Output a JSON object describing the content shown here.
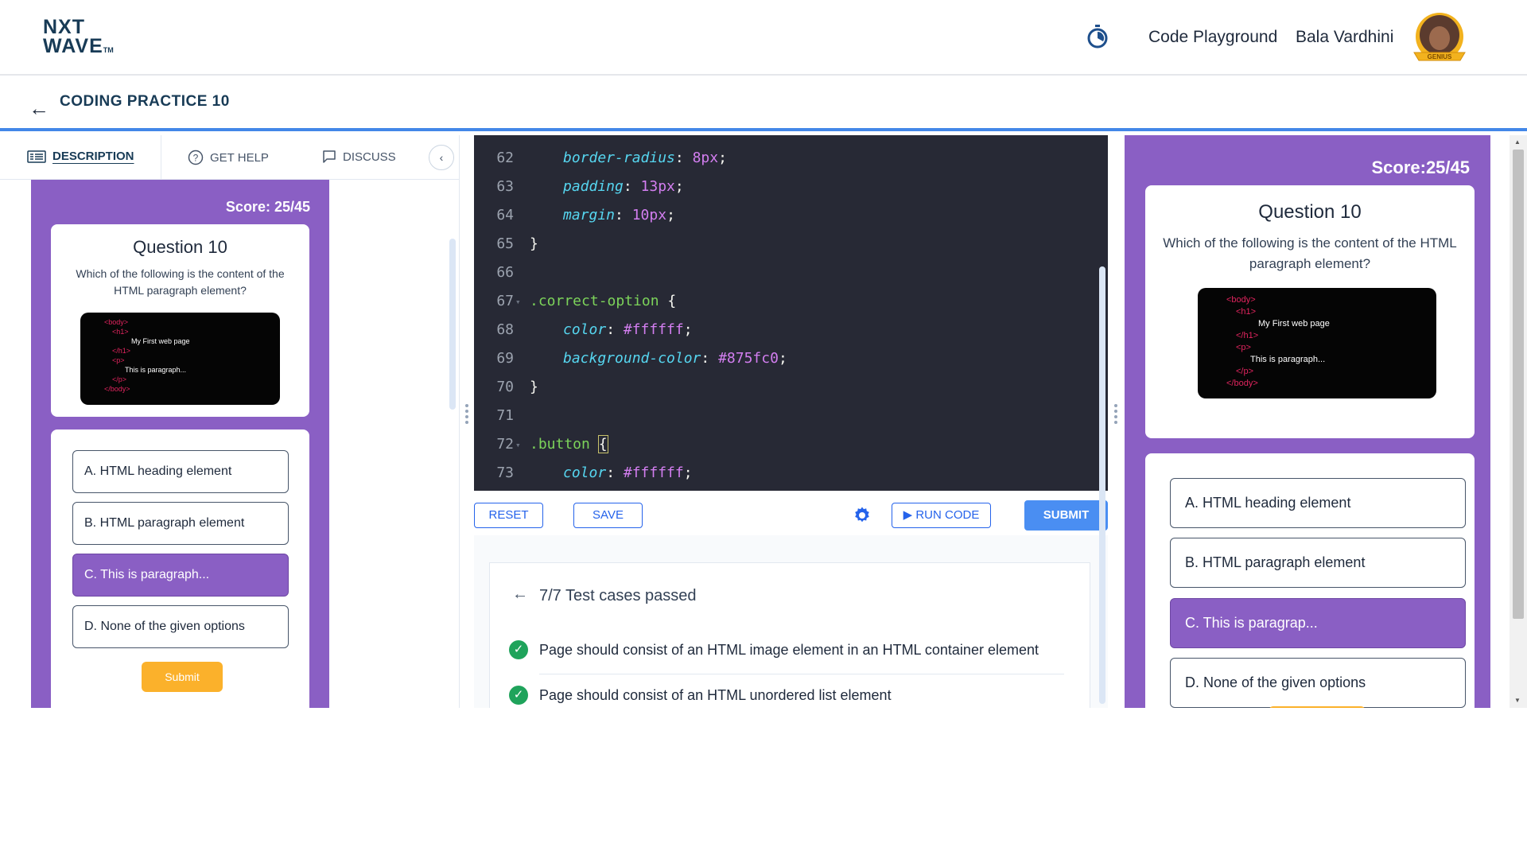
{
  "header": {
    "logo_line1": "NXT",
    "logo_line2": "WAVE",
    "logo_tm": "TM",
    "code_playground": "Code Playground",
    "user_name": "Bala Vardhini",
    "badge": "GENIUS"
  },
  "subheader": {
    "back": "←",
    "title": "CODING PRACTICE 10"
  },
  "tabs": {
    "description": "DESCRIPTION",
    "get_help": "GET HELP",
    "discuss": "DISCUSS",
    "collapse": "‹"
  },
  "quiz_small": {
    "score": "Score: 25/45",
    "question_title": "Question 10",
    "question_text": "Which of the following is the content of the HTML paragraph element?",
    "code": [
      "<body>",
      "<h1>",
      "My First web page",
      "</h1>",
      "<p>",
      "This is paragraph...",
      "</p>",
      "</body>"
    ],
    "options": [
      "A. HTML heading element",
      "B. HTML paragraph element",
      "C. This is paragraph...",
      "D. None of the given options"
    ],
    "submit": "Submit"
  },
  "editor": {
    "lines": [
      {
        "n": "62",
        "prop": "border-radius",
        "val": "8px"
      },
      {
        "n": "63",
        "prop": "padding",
        "val": "13px"
      },
      {
        "n": "64",
        "prop": "margin",
        "val": "10px"
      },
      {
        "n": "65",
        "text": "}"
      },
      {
        "n": "66",
        "text": ""
      },
      {
        "n": "67",
        "selector": ".correct-option",
        "brace": "{"
      },
      {
        "n": "68",
        "prop": "color",
        "val": "#ffffff"
      },
      {
        "n": "69",
        "prop": "background-color",
        "val": "#875fc0"
      },
      {
        "n": "70",
        "text": "}"
      },
      {
        "n": "71",
        "text": ""
      },
      {
        "n": "72",
        "selector": ".button",
        "brace": "{"
      },
      {
        "n": "73",
        "prop": "color",
        "val": "#ffffff"
      }
    ]
  },
  "toolbar": {
    "reset": "RESET",
    "save": "SAVE",
    "run_code": "RUN CODE",
    "submit": "SUBMIT"
  },
  "results": {
    "title": "7/7 Test cases passed",
    "cases": [
      "Page should consist of an HTML image element in an HTML container element",
      "Page should consist of an HTML unordered list element"
    ]
  },
  "quiz_big": {
    "score": "Score:25/45",
    "question_title": "Question 10",
    "question_text": "Which of the following is the content of the HTML paragraph element?",
    "code": [
      "<body>",
      "<h1>",
      "My First web page",
      "</h1>",
      "<p>",
      "This is paragraph...",
      "</p>",
      "</body>"
    ],
    "options": [
      "A. HTML heading element",
      "B. HTML paragraph element",
      "C. This is paragrap...",
      "D. None of the given options"
    ]
  },
  "colors": {
    "accent_blue": "#4387e8",
    "quiz_purple": "#8a5fc4",
    "submit_yellow": "#fbb12b",
    "pass_green": "#1fa35b"
  }
}
